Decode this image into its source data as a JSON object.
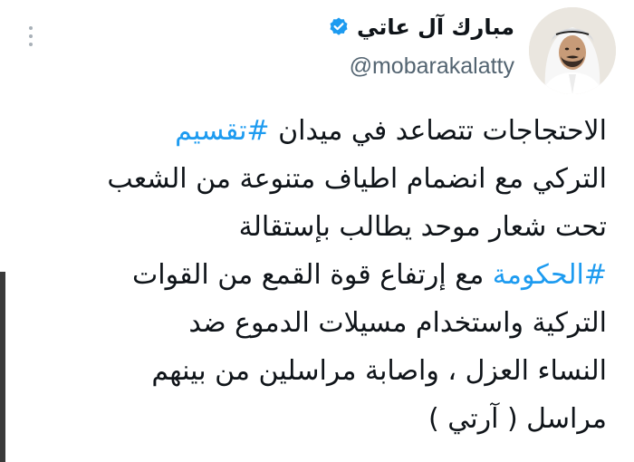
{
  "author": {
    "display_name": "مبارك آل عاتي",
    "handle": "@mobarakalatty",
    "verified": true,
    "verified_icon": "verified-badge-icon",
    "verified_color": "#1d9bf0"
  },
  "menu": {
    "icon": "more-vertical-icon"
  },
  "tweet": {
    "hashtag_color": "#1d9bf0",
    "segments": {
      "l1_text": "الاحتجاجات تتصاعد في ميدان ",
      "l1_hashtag": "#تقسيم",
      "l2_text": "التركي مع انضمام اطياف متنوعة من الشعب",
      "l3_text": "تحت شعار موحد يطالب بإستقالة",
      "l4_hashtag": "#الحكومة",
      "l4_text": " مع إرتفاع قوة القمع من القوات",
      "l5_text": "التركية واستخدام مسيلات الدموع ضد",
      "l6_text": "النساء العزل ، واصابة مراسلين من بينهم",
      "l7_text": "مراسل ( آرتي )"
    }
  }
}
